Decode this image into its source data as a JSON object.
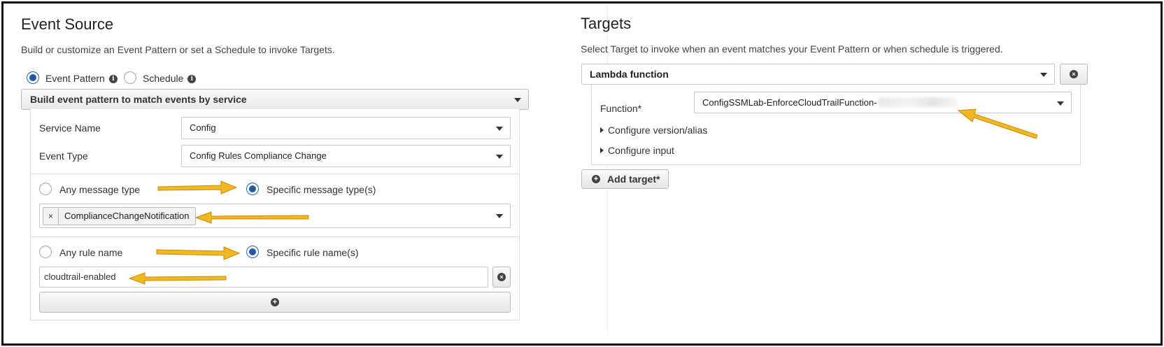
{
  "event_source": {
    "title": "Event Source",
    "description": "Build or customize an Event Pattern or set a Schedule to invoke Targets.",
    "mode": {
      "event_pattern_label": "Event Pattern",
      "schedule_label": "Schedule",
      "selected": "event_pattern"
    },
    "pattern_builder": {
      "header": "Build event pattern to match events by service",
      "service_name": {
        "label": "Service Name",
        "value": "Config"
      },
      "event_type": {
        "label": "Event Type",
        "value": "Config Rules Compliance Change"
      },
      "message_type": {
        "any_label": "Any message type",
        "specific_label": "Specific message type(s)",
        "selected": "specific",
        "tags": [
          "ComplianceChangeNotification"
        ],
        "tag_remove_glyph": "×"
      },
      "rule_name": {
        "any_label": "Any rule name",
        "specific_label": "Specific rule name(s)",
        "selected": "specific",
        "value": "cloudtrail-enabled"
      }
    }
  },
  "targets": {
    "title": "Targets",
    "description": "Select Target to invoke when an event matches your Event Pattern or when schedule is triggered.",
    "target_type": "Lambda function",
    "function": {
      "label": "Function*",
      "value": "ConfigSSMLab-EnforceCloudTrailFunction-"
    },
    "configure_version_alias": "Configure version/alias",
    "configure_input": "Configure input",
    "add_target_label": "Add target*"
  },
  "icons": {
    "info": "info-icon",
    "remove": "remove-circle-icon",
    "add": "plus-circle-icon",
    "caret": "caret-down-icon",
    "expand": "triangle-right-icon",
    "annotation": "arrow-annotation"
  },
  "colors": {
    "radio_selected": "#1f5aa6",
    "annotation_arrow": "#f2b81f"
  }
}
